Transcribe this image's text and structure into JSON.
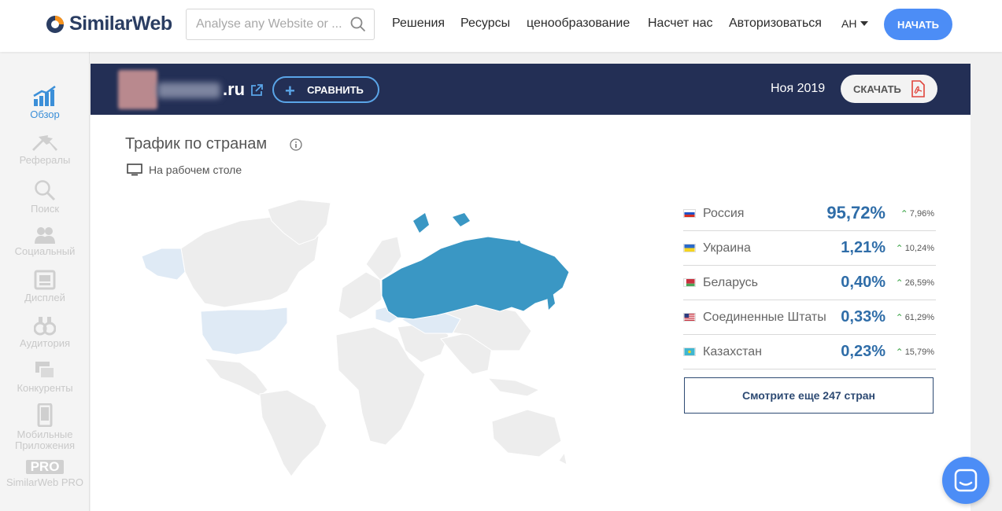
{
  "app": {
    "logo_text": "SimilarWeb"
  },
  "search": {
    "placeholder": "Analyse any Website or ...",
    "icon": "search-icon"
  },
  "nav": {
    "items": [
      "Решения",
      "Ресурсы",
      "ценообразование",
      "Насчет нас",
      "Авторизоваться"
    ],
    "lang": "АН",
    "start": "НАЧАТЬ"
  },
  "sidebar": {
    "items": [
      {
        "label": "Обзор",
        "icon": "chart-icon",
        "active": true
      },
      {
        "label": "Рефералы",
        "icon": "referrals-icon"
      },
      {
        "label": "Поиск",
        "icon": "search-icon"
      },
      {
        "label": "Социальный",
        "icon": "social-icon"
      },
      {
        "label": "Дисплей",
        "icon": "display-icon"
      },
      {
        "label": "Аудитория",
        "icon": "binoculars-icon"
      },
      {
        "label": "Конкуренты",
        "icon": "competitors-icon"
      },
      {
        "label": "Мобильные Приложения",
        "icon": "mobile-icon"
      },
      {
        "label": "SimilarWeb PRO",
        "icon": "pro-icon",
        "badge": "PRO"
      }
    ]
  },
  "header": {
    "site_tld": ".ru",
    "compare": "СРАВНИТЬ",
    "date": "Ноя 2019",
    "download": "СКАЧАТЬ"
  },
  "section": {
    "title": "Трафик по странам",
    "device": "На рабочем столе"
  },
  "countries": [
    {
      "name": "Россия",
      "pct": "95,72%",
      "change": "7,96%",
      "flag": "ru"
    },
    {
      "name": "Украина",
      "pct": "1,21%",
      "change": "10,24%",
      "flag": "ua"
    },
    {
      "name": "Беларусь",
      "pct": "0,40%",
      "change": "26,59%",
      "flag": "by"
    },
    {
      "name": "Соединенные Штаты",
      "pct": "0,33%",
      "change": "61,29%",
      "flag": "us"
    },
    {
      "name": "Казахстан",
      "pct": "0,23%",
      "change": "15,79%",
      "flag": "kz"
    }
  ],
  "more": "Смотрите еще 247 стран",
  "colors": {
    "brand": "#232f55",
    "accent": "#4c8df6",
    "map_highlight": "#3a97c4",
    "map_light": "#e2eef8",
    "up": "#3fa64a",
    "arrow": "#52b42d"
  }
}
